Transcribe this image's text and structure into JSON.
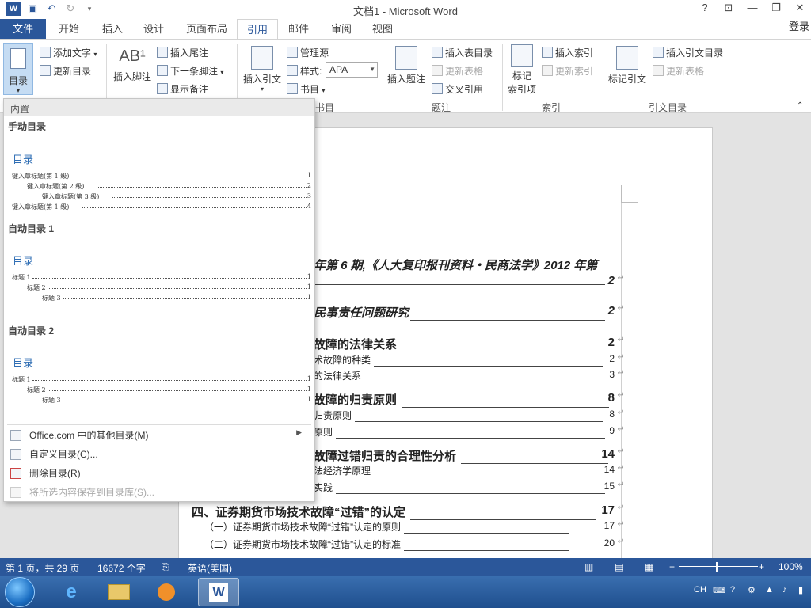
{
  "window": {
    "title": "文档1 - Microsoft Word",
    "help": "?",
    "login": "登录"
  },
  "tabs": [
    "文件",
    "开始",
    "插入",
    "设计",
    "页面布局",
    "引用",
    "邮件",
    "审阅",
    "视图"
  ],
  "ribbon": {
    "toc": {
      "label": "目录",
      "add_text": "添加文字",
      "update": "更新目录"
    },
    "footnotes": {
      "insert_footnote": "插入脚注",
      "insert_endnote": "插入尾注",
      "next_footnote": "下一条脚注",
      "show_notes": "显示备注"
    },
    "citations": {
      "insert_citation": "插入引文",
      "manage_sources": "管理源",
      "style_label": "样式:",
      "style_value": "APA",
      "bibliography": "书目",
      "group_label": "书目"
    },
    "captions": {
      "insert_caption": "插入题注",
      "insert_table_of_figures": "插入表目录",
      "update_table": "更新表格",
      "cross_reference": "交叉引用",
      "group_label": "题注"
    },
    "index": {
      "mark_entry": "标记",
      "mark_entry_2": "索引项",
      "insert_index": "插入索引",
      "update_index": "更新索引",
      "group_label": "索引"
    },
    "toa": {
      "mark_citation": "标记引文",
      "insert_toa": "插入引文目录",
      "update_table": "更新表格",
      "group_label": "引文目录"
    }
  },
  "gallery": {
    "header": "内置",
    "manual_title": "手动目录",
    "manual_heading": "目录",
    "manual_rows": [
      {
        "text": "键入章标题(第 1 级)",
        "page": "1"
      },
      {
        "text": "键入章标题(第 2 级)",
        "page": "2"
      },
      {
        "text": "键入章标题(第 3 级)",
        "page": "3"
      },
      {
        "text": "键入章标题(第 1 级)",
        "page": "4"
      }
    ],
    "auto1_title": "自动目录 1",
    "auto1_heading": "目录",
    "auto2_title": "自动目录 2",
    "auto2_heading": "目录",
    "auto_rows": [
      {
        "text": "标题 1",
        "page": "1"
      },
      {
        "text": "标题 2",
        "page": "1"
      },
      {
        "text": "标题 3",
        "page": "1"
      }
    ],
    "menu": {
      "more_office": "Office.com 中的其他目录(M)",
      "custom": "自定义目录(C)...",
      "remove": "删除目录(R)",
      "save_selection": "将所选内容保存到目录库(S)..."
    }
  },
  "document": {
    "lines": [
      {
        "text": "年第 6 期,《人大复印报刊资料・民商法学》2012 年第",
        "page": "",
        "cls": "lv1i"
      },
      {
        "text": "",
        "page": "2",
        "cls": "lv1i"
      },
      {
        "text": "民事责任问题研究",
        "page": "2",
        "cls": "lv1i"
      },
      {
        "text": "故障的法律关系",
        "page": "2",
        "cls": "lv1"
      },
      {
        "text": "术故障的种类",
        "page": "2",
        "cls": ""
      },
      {
        "text": "的法律关系",
        "page": "3",
        "cls": ""
      },
      {
        "text": "故障的归责原则",
        "page": "8",
        "cls": "lv1"
      },
      {
        "text": "归责原则",
        "page": "8",
        "cls": ""
      },
      {
        "text": "原则",
        "page": "9",
        "cls": ""
      },
      {
        "text": "故障过错归责的合理性分析",
        "page": "14",
        "cls": "lv1"
      },
      {
        "text": "法经济学原理",
        "page": "14",
        "cls": ""
      },
      {
        "text": "实践",
        "page": "15",
        "cls": ""
      },
      {
        "text": "四、证券期货市场技术故障“过错”的认定",
        "page": "17",
        "cls": "lv1"
      },
      {
        "text": "（一）证券期货市场技术故障“过错”认定的原则",
        "page": "17",
        "cls": ""
      },
      {
        "text": "（二）证券期货市场技术故障“过错”认定的标准",
        "page": "20",
        "cls": ""
      }
    ]
  },
  "status": {
    "page": "第 1 页，共 29 页",
    "words": "16672 个字",
    "language": "英语(美国)",
    "zoom": "100%"
  },
  "taskbar": {
    "ime": "CH"
  },
  "colors": {
    "accent": "#2b579a",
    "ribbon_highlight": "#c5dcf3",
    "gallery_heading": "#2e6db4"
  }
}
